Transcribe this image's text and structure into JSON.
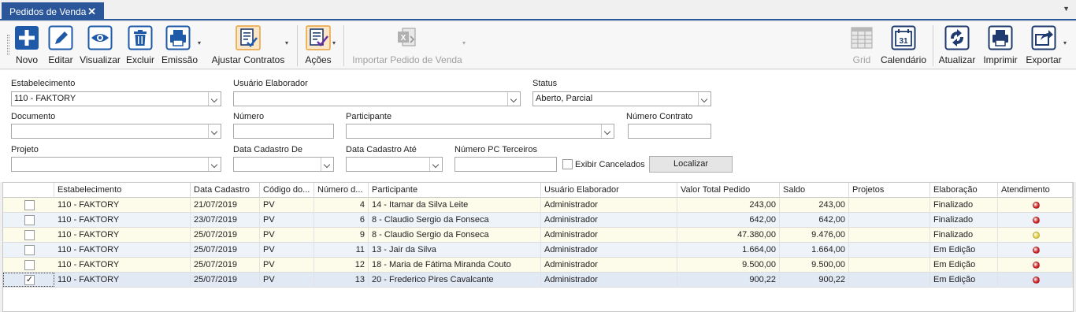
{
  "tab": {
    "title": "Pedidos de Venda",
    "close": "✕"
  },
  "toolbar": {
    "novo": "Novo",
    "editar": "Editar",
    "visualizar": "Visualizar",
    "excluir": "Excluir",
    "emissao": "Emissão",
    "ajustar": "Ajustar Contratos",
    "acoes": "Ações",
    "importar": "Importar Pedido de Venda",
    "grid": "Grid",
    "calendario": "Calendário",
    "calendario_day": "31",
    "atualizar": "Atualizar",
    "imprimir": "Imprimir",
    "exportar": "Exportar"
  },
  "filters": {
    "estabelecimento_label": "Estabelecimento",
    "estabelecimento_value": "110 - FAKTORY",
    "usuario_label": "Usuário Elaborador",
    "usuario_value": "",
    "status_label": "Status",
    "status_value": "Aberto, Parcial",
    "documento_label": "Documento",
    "documento_value": "",
    "numero_label": "Número",
    "numero_value": "",
    "participante_label": "Participante",
    "participante_value": "",
    "contrato_label": "Número Contrato",
    "contrato_value": "",
    "projeto_label": "Projeto",
    "projeto_value": "",
    "data_de_label": "Data Cadastro De",
    "data_de_value": "",
    "data_ate_label": "Data Cadastro Até",
    "data_ate_value": "",
    "pc_label": "Número PC Terceiros",
    "pc_value": "",
    "cancelados_label": "Exibir Cancelados",
    "cancelados_checked": false,
    "localizar": "Localizar"
  },
  "grid": {
    "columns": [
      "Estabelecimento",
      "Data Cadastro",
      "Código do...",
      "Número d...",
      "Participante",
      "Usuário Elaborador",
      "Valor Total Pedido",
      "Saldo",
      "Projetos",
      "Elaboração",
      "Atendimento"
    ],
    "rows": [
      {
        "checked": false,
        "estab": "110 - FAKTORY",
        "data": "21/07/2019",
        "cod": "PV",
        "num": "4",
        "part": "14 - Itamar da Silva Leite",
        "user": "Administrador",
        "valor": "243,00",
        "saldo": "243,00",
        "proj": "",
        "elab": "Finalizado",
        "atend": "#d42020"
      },
      {
        "checked": false,
        "estab": "110 - FAKTORY",
        "data": "23/07/2019",
        "cod": "PV",
        "num": "6",
        "part": "8 - Claudio Sergio da Fonseca",
        "user": "Administrador",
        "valor": "642,00",
        "saldo": "642,00",
        "proj": "",
        "elab": "Finalizado",
        "atend": "#d42020"
      },
      {
        "checked": false,
        "estab": "110 - FAKTORY",
        "data": "25/07/2019",
        "cod": "PV",
        "num": "9",
        "part": "8 - Claudio Sergio da Fonseca",
        "user": "Administrador",
        "valor": "47.380,00",
        "saldo": "9.476,00",
        "proj": "",
        "elab": "Finalizado",
        "atend": "#e8d33a"
      },
      {
        "checked": false,
        "estab": "110 - FAKTORY",
        "data": "25/07/2019",
        "cod": "PV",
        "num": "11",
        "part": "13 - Jair da Silva",
        "user": "Administrador",
        "valor": "1.664,00",
        "saldo": "1.664,00",
        "proj": "",
        "elab": "Em Edição",
        "atend": "#d42020"
      },
      {
        "checked": false,
        "estab": "110 - FAKTORY",
        "data": "25/07/2019",
        "cod": "PV",
        "num": "12",
        "part": "18 - Maria de Fátima Miranda Couto",
        "user": "Administrador",
        "valor": "9.500,00",
        "saldo": "9.500,00",
        "proj": "",
        "elab": "Em Edição",
        "atend": "#d42020"
      },
      {
        "checked": true,
        "estab": "110 - FAKTORY",
        "data": "25/07/2019",
        "cod": "PV",
        "num": "13",
        "part": "20 - Frederico Pires Cavalcante",
        "user": "Administrador",
        "valor": "900,22",
        "saldo": "900,22",
        "proj": "",
        "elab": "Em Edição",
        "atend": "#d42020"
      }
    ]
  }
}
